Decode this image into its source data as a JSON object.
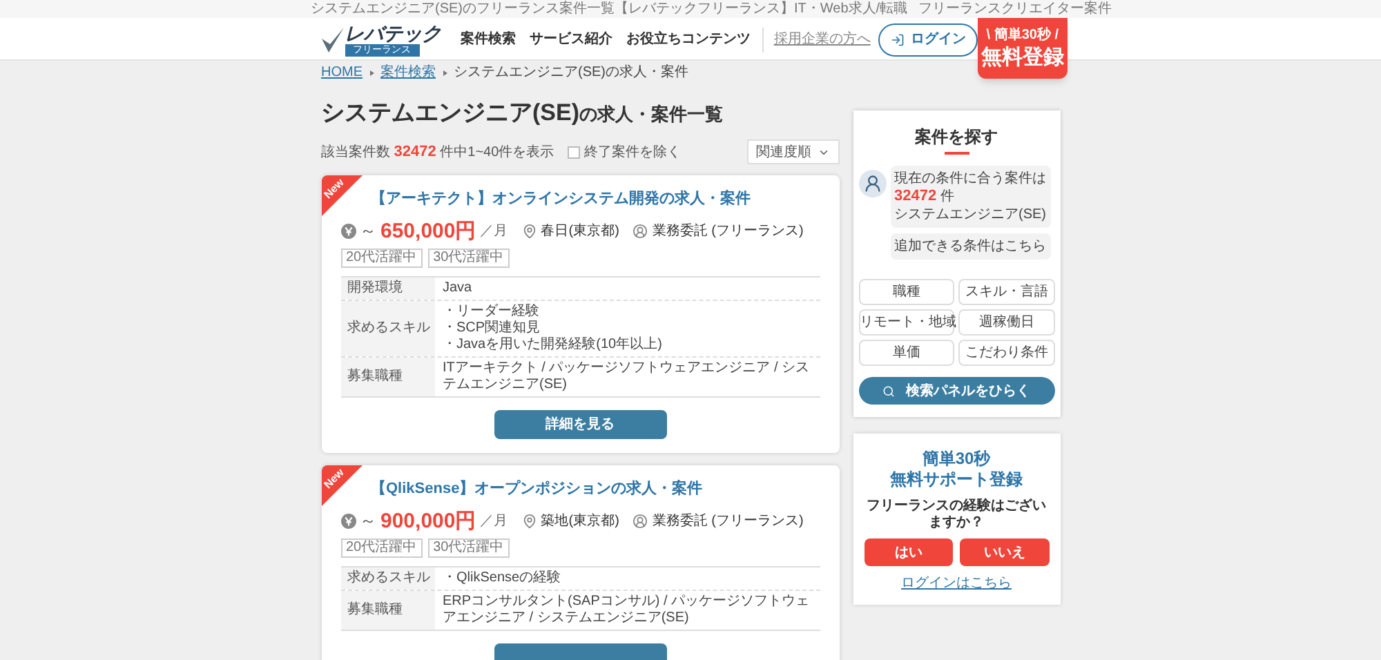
{
  "top_bar": {
    "title": "システムエンジニア(SE)のフリーランス案件一覧【レバテックフリーランス】",
    "links": [
      "IT・Web求人/転職",
      "フリーランスクリエイター案件"
    ]
  },
  "header": {
    "logo": {
      "name": "レバテック",
      "sub": "フリーランス"
    },
    "nav": [
      "案件検索",
      "サービス紹介",
      "お役立ちコンテンツ"
    ],
    "recruiter_link": "採用企業の方へ",
    "login_button": "ログイン",
    "signup": {
      "sub": "\\ 簡単30秒 /",
      "main": "無料登録"
    }
  },
  "breadcrumbs": [
    {
      "label": "HOME",
      "current": false
    },
    {
      "label": "案件検索",
      "current": false
    },
    {
      "label": "システムエンジニア(SE)の求人・案件",
      "current": true
    }
  ],
  "page_title": {
    "main": "システムエンジニア(SE)",
    "suffix": "の求人・案件一覧"
  },
  "result_summary": {
    "label": "該当案件数",
    "count": "32472",
    "suffix": "件中1~40件を表示"
  },
  "exclude_closed": {
    "label": "終了案件を除く",
    "checked": false
  },
  "sort": {
    "value": "関連度順"
  },
  "jobs": [
    {
      "is_new": true,
      "badge": "New",
      "title": "【アーキテクト】オンラインシステム開発の求人・案件",
      "price_prefix": "～",
      "price": "650,000円",
      "unit": "／月",
      "location": "春日(東京都)",
      "contract": "業務委託 (フリーランス)",
      "tags": [
        "20代活躍中",
        "30代活躍中"
      ],
      "details": [
        {
          "label": "開発環境",
          "lines": [
            "Java"
          ]
        },
        {
          "label": "求めるスキル",
          "lines": [
            "・リーダー経験",
            "・SCP関連知見",
            "・Javaを用いた開発経験(10年以上)"
          ]
        },
        {
          "label": "募集職種",
          "lines": [
            "ITアーキテクト / パッケージソフトウェアエンジニア / システムエンジニア(SE)"
          ]
        }
      ],
      "button": "詳細を見る"
    },
    {
      "is_new": true,
      "badge": "New",
      "title": "【QlikSense】オープンポジションの求人・案件",
      "price_prefix": "～",
      "price": "900,000円",
      "unit": "／月",
      "location": "築地(東京都)",
      "contract": "業務委託 (フリーランス)",
      "tags": [
        "20代活躍中",
        "30代活躍中"
      ],
      "details": [
        {
          "label": "求めるスキル",
          "lines": [
            "・QlikSenseの経験"
          ]
        },
        {
          "label": "募集職種",
          "lines": [
            "ERPコンサルタント(SAPコンサル) / パッケージソフトウェアエンジニア / システムエンジニア(SE)"
          ]
        }
      ]
    }
  ],
  "search_panel": {
    "title": "案件を探す",
    "message": {
      "line_1": "現在の条件に合う案件は",
      "count": "32472",
      "count_unit": "件",
      "line_3": "システムエンジニア(SE)"
    },
    "addable": "追加できる条件はこちら",
    "filters": [
      "職種",
      "スキル・言語",
      "リモート・地域",
      "週稼働日",
      "単価",
      "こだわり条件"
    ],
    "search_button": "検索パネルをひらく"
  },
  "support": {
    "title_1": "簡単30秒",
    "title_2": "無料サポート登録",
    "question": "フリーランスの経験はございますか？",
    "yes": "はい",
    "no": "いいえ",
    "login_link": "ログインはこちら"
  }
}
